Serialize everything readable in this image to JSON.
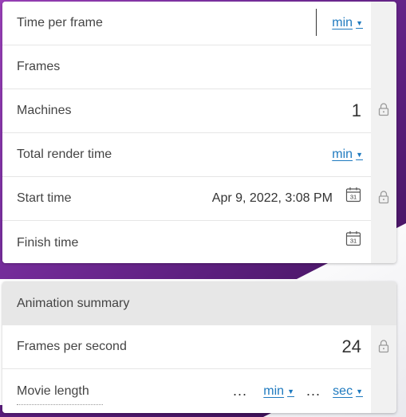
{
  "card1": {
    "rows": [
      {
        "label": "Time per frame",
        "unit": "min"
      },
      {
        "label": "Frames"
      },
      {
        "label": "Machines",
        "value": "1"
      },
      {
        "label": "Total render time",
        "unit": "min"
      },
      {
        "label": "Start time",
        "value": "Apr 9, 2022, 3:08 PM"
      },
      {
        "label": "Finish time"
      }
    ]
  },
  "card2": {
    "header": "Animation summary",
    "rows": [
      {
        "label": "Frames per second",
        "value": "24"
      },
      {
        "label": "Movie length",
        "placeholder1": "...",
        "unit1": "min",
        "placeholder2": "...",
        "unit2": "sec"
      }
    ]
  },
  "icons": {
    "lock": "lock-icon",
    "calendar": "calendar-icon",
    "calendar_day": "31",
    "caret": "caret-down-icon"
  },
  "colors": {
    "link": "#1f7abf",
    "purple": "#5c1f7e"
  }
}
